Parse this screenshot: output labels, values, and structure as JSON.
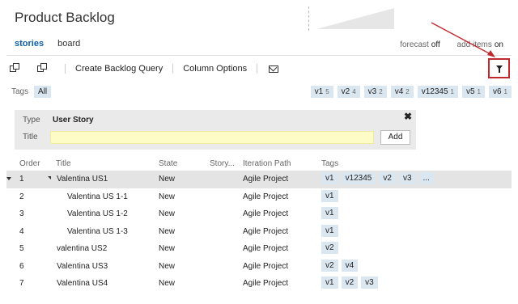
{
  "page": {
    "title": "Product Backlog"
  },
  "pivots": {
    "stories": "stories",
    "board": "board"
  },
  "toggles": {
    "forecast_label": "forecast",
    "forecast_value": "off",
    "inprogress_label": "add items",
    "inprogress_value": "on"
  },
  "toolbar": {
    "create_query": "Create Backlog Query",
    "column_options": "Column Options"
  },
  "tagbar": {
    "label": "Tags",
    "all": "All",
    "filters": [
      {
        "name": "v1",
        "count": "5"
      },
      {
        "name": "v2",
        "count": "4"
      },
      {
        "name": "v3",
        "count": "2"
      },
      {
        "name": "v4",
        "count": "2"
      },
      {
        "name": "v12345",
        "count": "1"
      },
      {
        "name": "v5",
        "count": "1"
      },
      {
        "name": "v6",
        "count": "1"
      }
    ]
  },
  "addpanel": {
    "type_label": "Type",
    "type_value": "User Story",
    "title_label": "Title",
    "add_button": "Add",
    "close_glyph": "✖"
  },
  "grid": {
    "columns": [
      "Order",
      "Title",
      "State",
      "Story...",
      "Iteration Path",
      "Tags"
    ],
    "rows": [
      {
        "order": "1",
        "title": "Valentina US1",
        "state": "New",
        "iteration": "Agile Project",
        "tags": [
          "v1",
          "v12345",
          "v2",
          "v3",
          "..."
        ]
      },
      {
        "order": "2",
        "title": "Valentina US 1-1",
        "state": "New",
        "iteration": "Agile Project",
        "tags": [
          "v1"
        ]
      },
      {
        "order": "3",
        "title": "Valentina US 1-2",
        "state": "New",
        "iteration": "Agile Project",
        "tags": [
          "v1"
        ]
      },
      {
        "order": "4",
        "title": "Valentina US 1-3",
        "state": "New",
        "iteration": "Agile Project",
        "tags": [
          "v1"
        ]
      },
      {
        "order": "5",
        "title": "valentina US2",
        "state": "New",
        "iteration": "Agile Project",
        "tags": [
          "v2"
        ]
      },
      {
        "order": "6",
        "title": "Valentina US3",
        "state": "New",
        "iteration": "Agile Project",
        "tags": [
          "v2",
          "v4"
        ]
      },
      {
        "order": "7",
        "title": "Valentina US4",
        "state": "New",
        "iteration": "Agile Project",
        "tags": [
          "v1",
          "v2",
          "v3"
        ]
      }
    ]
  },
  "colors": {
    "accent": "#0f5ea8",
    "tag_bg": "#dae6f0",
    "highlight": "#c0282d",
    "title_input_bg": "#fdfbc6"
  },
  "icons": {
    "expand_all": "expand-all-icon",
    "collapse_all": "collapse-all-icon",
    "email": "email-icon",
    "filter": "filter-icon"
  }
}
